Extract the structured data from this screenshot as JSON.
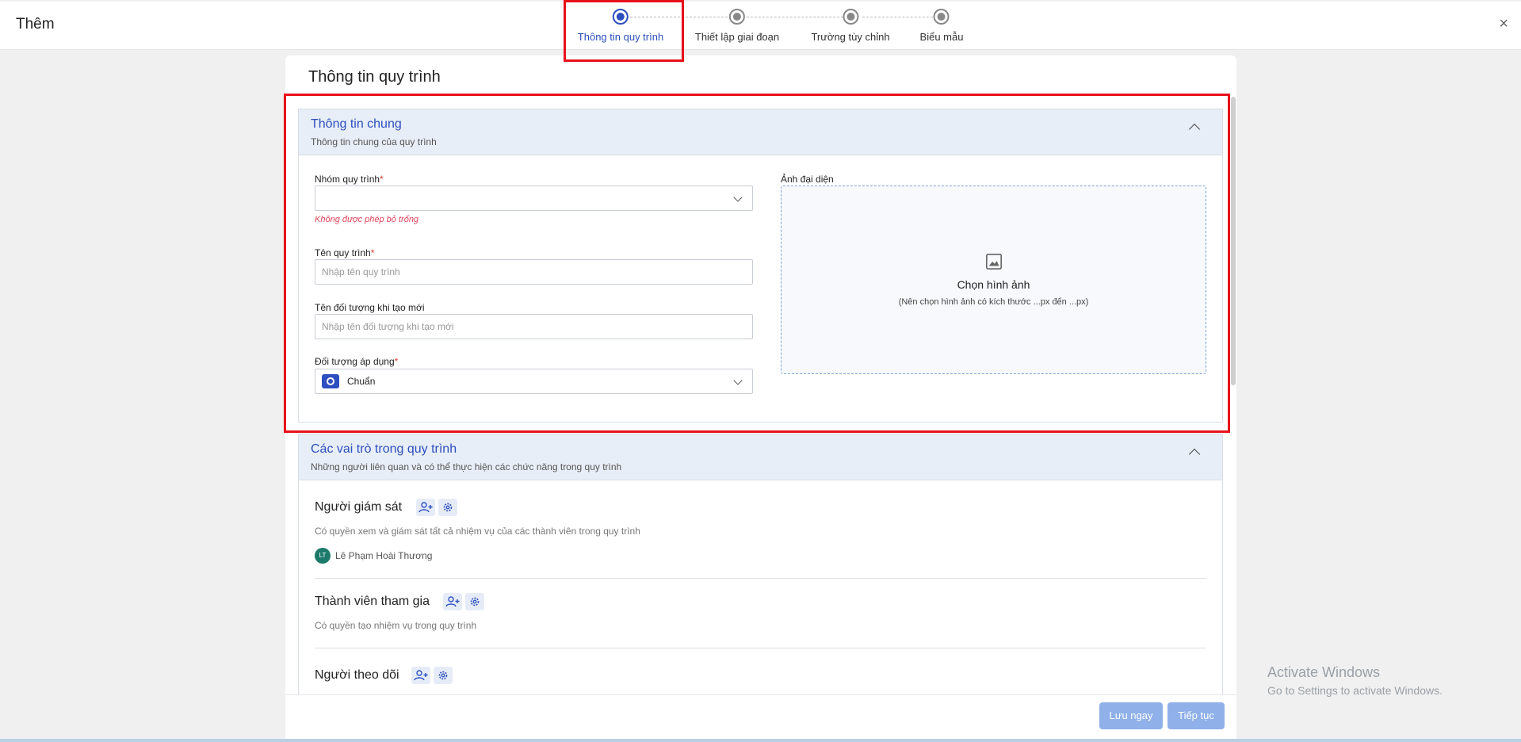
{
  "header": {
    "title": "Thêm",
    "close_icon": "×"
  },
  "stepper": {
    "steps": [
      {
        "label": "Thông tin quy trình",
        "active": true
      },
      {
        "label": "Thiết lập giai đoạn",
        "active": false
      },
      {
        "label": "Trường tùy chỉnh",
        "active": false
      },
      {
        "label": "Biểu mẫu",
        "active": false
      }
    ]
  },
  "panel": {
    "title": "Thông tin quy trình"
  },
  "general": {
    "title": "Thông tin chung",
    "subtitle": "Thông tin chung của quy trình",
    "group_label": "Nhóm quy trình",
    "group_value": "",
    "group_error": "Không được phép bỏ trống",
    "name_label": "Tên quy trình",
    "name_placeholder": "Nhập tên quy trình",
    "object_name_label": "Tên đối tượng khi tạo mới",
    "object_name_placeholder": "Nhập tên đối tượng khi tạo mới",
    "apply_label": "Đối tượng áp dụng",
    "apply_value": "Chuẩn",
    "required_mark": "*",
    "avatar_label": "Ảnh đại diện",
    "upload_title": "Chọn hình ảnh",
    "upload_hint": "(Nên chọn hình ảnh có kích thước ...px đến ...px)"
  },
  "roles": {
    "title": "Các vai trò trong quy trình",
    "subtitle": "Những người liên quan và có thể thực hiện các chức năng trong quy trình",
    "items": [
      {
        "title": "Người giám sát",
        "desc": "Có quyền xem và giám sát tất cả nhiệm vụ của các thành viên trong quy trình",
        "member_initials": "LT",
        "member_name": "Lê Phạm Hoài Thương"
      },
      {
        "title": "Thành viên tham gia",
        "desc": "Có quyền tạo nhiệm vụ trong quy trình"
      },
      {
        "title": "Người theo dõi"
      }
    ]
  },
  "footer": {
    "save_label": "Lưu ngay",
    "next_label": "Tiếp tục"
  },
  "watermark": {
    "line1": "Activate Windows",
    "line2": "Go to Settings to activate Windows."
  },
  "colors": {
    "accent": "#2d4fbf",
    "highlight": "#e8101a",
    "error": "#e0455a",
    "button": "#8fb0e8"
  }
}
